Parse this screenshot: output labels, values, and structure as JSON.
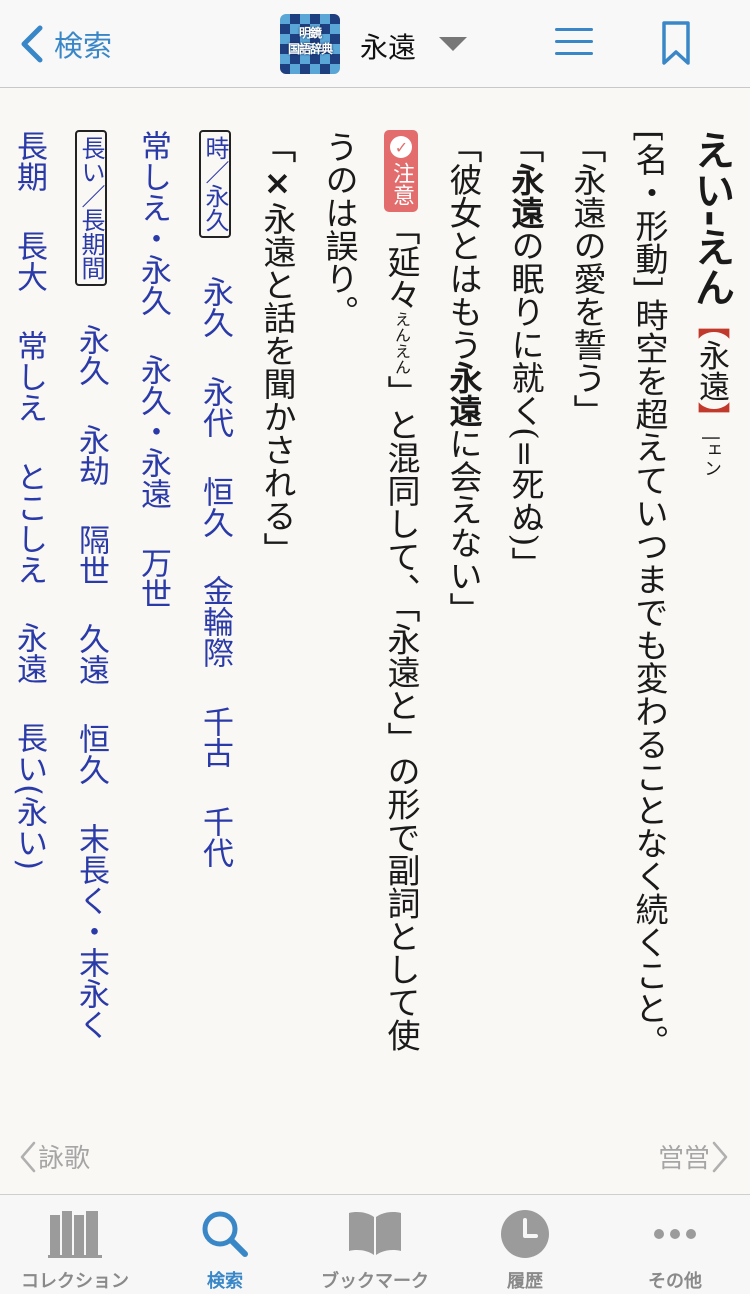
{
  "header": {
    "back_label": "検索",
    "app_icon_line1": "明鏡",
    "app_icon_line2": "国語辞典",
    "dict_title": "永遠"
  },
  "entry": {
    "headword": "えい-えん",
    "kanji_open": "【",
    "kanji": "永遠",
    "kanji_close": "】",
    "accent": "|ェン",
    "pos": "[名・形動]",
    "definition": "時空を超えていつまでも変わることなく続くこと。",
    "ex1": "「永遠の愛を誓う」",
    "ex2_open": "「",
    "ex2_bold": "永遠",
    "ex2_rest": "の眠りに就く(=死ぬ)」",
    "ex3_pre": "「彼女とはもう",
    "ex3_bold": "永遠",
    "ex3_post": "に会えない」",
    "notice_label": "注意",
    "notice_text_1": "「延々",
    "notice_reading": "えんえん",
    "notice_text_2": "」と混同して、「永遠と」の形で副詞として使うのは誤り。",
    "wrong_mark": "×",
    "wrong_example": "永遠と話を聞かされる」",
    "wrong_open": "「"
  },
  "synonyms": [
    {
      "label": "時／永久",
      "items": [
        "永久",
        "永代",
        "恒久",
        "金輪際",
        "千古",
        "千代"
      ]
    },
    {
      "label": "",
      "items": [
        "常しえ・永久",
        "永久・永遠",
        "万世"
      ]
    },
    {
      "label": "長い／長期間",
      "items": [
        "永久",
        "永劫",
        "隔世",
        "久遠",
        "恒久",
        "末長く・末永く"
      ]
    },
    {
      "label": "",
      "items": [
        "長期",
        "長大",
        "常しえ",
        "とこしえ",
        "永遠",
        "長い(永い)"
      ]
    }
  ],
  "nav": {
    "prev_label": "詠歌",
    "next_label": "営営"
  },
  "tabs": [
    {
      "label": "コレクション",
      "active": false
    },
    {
      "label": "検索",
      "active": true
    },
    {
      "label": "ブックマーク",
      "active": false
    },
    {
      "label": "履歴",
      "active": false
    },
    {
      "label": "その他",
      "active": false
    }
  ],
  "colors": {
    "accent": "#3a87c8",
    "synonym": "#2a3aa8",
    "notice": "#e36d6d",
    "bracket": "#c0392b",
    "background": "#faf8f4"
  }
}
